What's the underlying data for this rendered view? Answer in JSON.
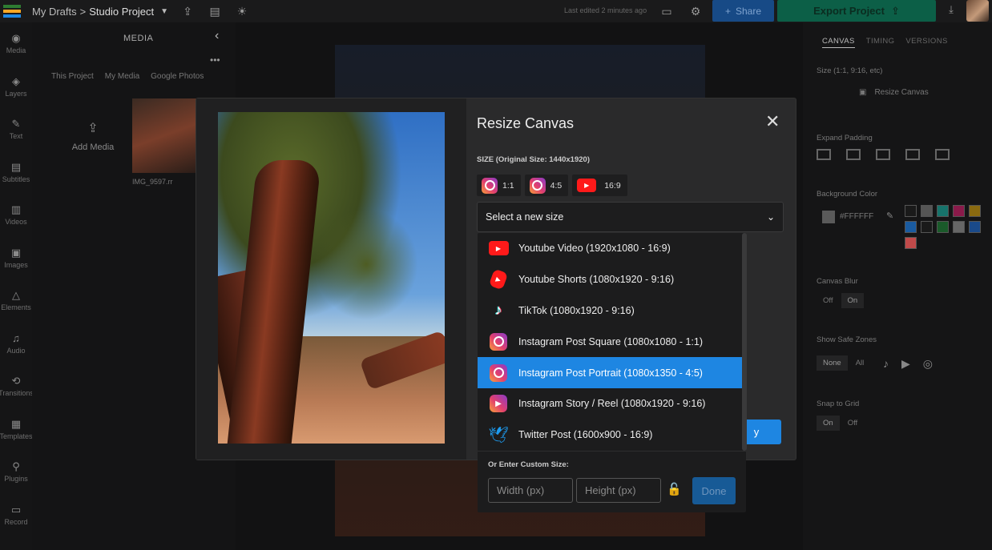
{
  "topbar": {
    "breadcrumb_root": "My Drafts",
    "breadcrumb_sep": ">",
    "project_name": "Studio Project",
    "last_edited": "Last edited 2 minutes ago",
    "share_label": "Share",
    "export_label": "Export Project"
  },
  "rail": {
    "items": [
      {
        "label": "Media",
        "icon": "media-icon",
        "glyph": "◉"
      },
      {
        "label": "Layers",
        "icon": "layers-icon",
        "glyph": "◈"
      },
      {
        "label": "Text",
        "icon": "text-icon",
        "glyph": "✎"
      },
      {
        "label": "Subtitles",
        "icon": "subtitles-icon",
        "glyph": "▤"
      },
      {
        "label": "Videos",
        "icon": "videos-icon",
        "glyph": "▥"
      },
      {
        "label": "Images",
        "icon": "images-icon",
        "glyph": "▣"
      },
      {
        "label": "Elements",
        "icon": "elements-icon",
        "glyph": "△"
      },
      {
        "label": "Audio",
        "icon": "audio-icon",
        "glyph": "♫"
      },
      {
        "label": "Transitions",
        "icon": "transitions-icon",
        "glyph": "⟲"
      },
      {
        "label": "Templates",
        "icon": "templates-icon",
        "glyph": "▦"
      },
      {
        "label": "Plugins",
        "icon": "plugins-icon",
        "glyph": "⚲"
      },
      {
        "label": "Record",
        "icon": "record-icon",
        "glyph": "▭"
      }
    ]
  },
  "media_panel": {
    "title": "MEDIA",
    "tabs": [
      "This Project",
      "My Media",
      "Google Photos"
    ],
    "add_media": "Add Media",
    "thumb_label": "IMG_9597.rr"
  },
  "right_panel": {
    "tabs": [
      "CANVAS",
      "TIMING",
      "VERSIONS"
    ],
    "size_label": "Size (1:1, 9:16, etc)",
    "resize_canvas": "Resize Canvas",
    "expand_padding": "Expand Padding",
    "background_color": "Background Color",
    "bg_hex": "#FFFFFF",
    "canvas_blur": "Canvas Blur",
    "blur_off": "Off",
    "blur_on": "On",
    "show_safe_zones": "Show Safe Zones",
    "safe_none": "None",
    "safe_all": "All",
    "snap_to_grid": "Snap to Grid",
    "snap_on": "On",
    "snap_off": "Off",
    "swatch_colors": [
      "#1a1a1a",
      "#555555",
      "#17736b",
      "#8a1a4a",
      "#8a6a10",
      "#1a5ba0",
      "#1a1a1a",
      "#1a5a2a",
      "#666666",
      "#1a4a8a",
      "#c04a4a"
    ]
  },
  "modal": {
    "title": "Resize Canvas",
    "size_info": "SIZE (Original Size: 1440x1920)",
    "quick_sizes": [
      {
        "icon": "instagram-icon",
        "label": "1:1"
      },
      {
        "icon": "instagram-icon",
        "label": "4:5"
      },
      {
        "icon": "youtube-icon",
        "label": "16:9"
      }
    ],
    "select_placeholder": "Select a new size",
    "apply_label": "y",
    "options": [
      {
        "icon": "youtube-icon",
        "label": "Youtube Video (1920x1080 - 16:9)"
      },
      {
        "icon": "youtube-shorts-icon",
        "label": "Youtube Shorts (1080x1920 - 9:16)"
      },
      {
        "icon": "tiktok-icon",
        "label": "TikTok (1080x1920 - 9:16)"
      },
      {
        "icon": "instagram-icon",
        "label": "Instagram Post Square (1080x1080 - 1:1)"
      },
      {
        "icon": "instagram-icon",
        "label": "Instagram Post Portrait (1080x1350 - 4:5)"
      },
      {
        "icon": "instagram-reel-icon",
        "label": "Instagram Story / Reel (1080x1920 - 9:16)"
      },
      {
        "icon": "twitter-icon",
        "label": "Twitter Post (1600x900 - 16:9)"
      }
    ],
    "selected_index": 4,
    "custom_size_title": "Or Enter Custom Size:",
    "width_placeholder": "Width (px)",
    "height_placeholder": "Height (px)",
    "done_label": "Done"
  },
  "colors": {
    "accent": "#1e86e2",
    "export": "#0c5f47",
    "share": "#174a86"
  }
}
